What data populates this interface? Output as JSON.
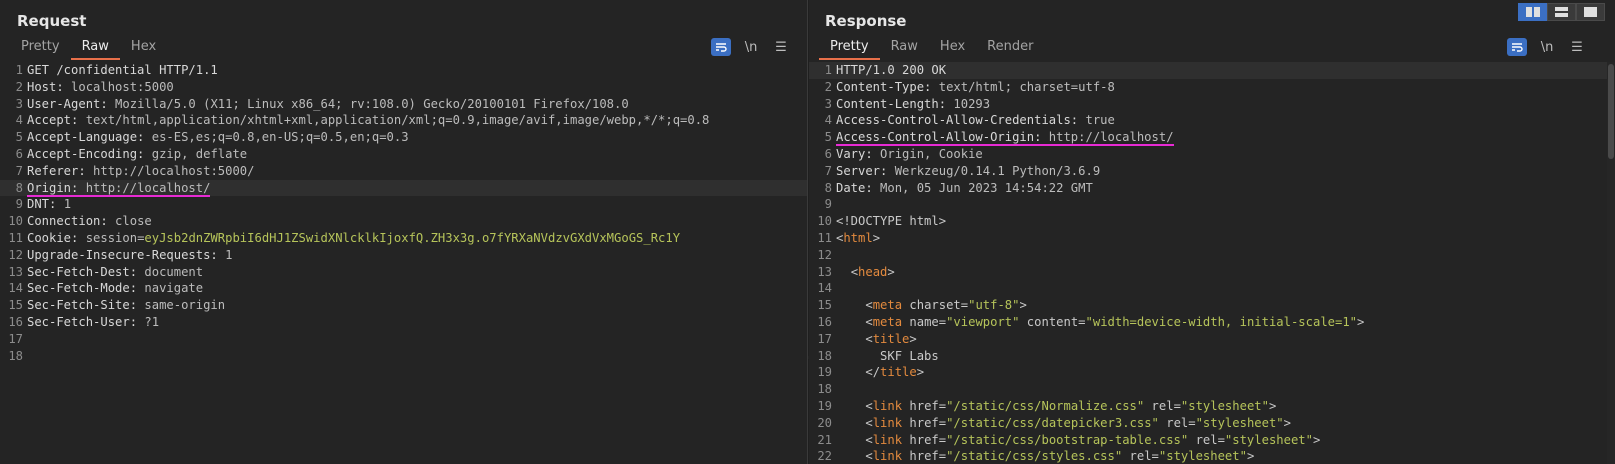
{
  "request": {
    "title": "Request",
    "tabs": [
      {
        "label": "Pretty",
        "active": false
      },
      {
        "label": "Raw",
        "active": true
      },
      {
        "label": "Hex",
        "active": false
      }
    ],
    "tools": {
      "wrap_icon": "wrap-icon",
      "newline_label": "\\n",
      "menu_icon": "menu-icon"
    },
    "lines": [
      {
        "n": "1",
        "k": "GET /confidential HTTP/1.1",
        "v": ""
      },
      {
        "n": "2",
        "k": "Host:",
        "v": " localhost:5000"
      },
      {
        "n": "3",
        "k": "User-Agent:",
        "v": " Mozilla/5.0 (X11; Linux x86_64; rv:108.0) Gecko/20100101 Firefox/108.0"
      },
      {
        "n": "4",
        "k": "Accept:",
        "v": " text/html,application/xhtml+xml,application/xml;q=0.9,image/avif,image/webp,*/*;q=0.8"
      },
      {
        "n": "5",
        "k": "Accept-Language:",
        "v": " es-ES,es;q=0.8,en-US;q=0.5,en;q=0.3"
      },
      {
        "n": "6",
        "k": "Accept-Encoding:",
        "v": " gzip, deflate"
      },
      {
        "n": "7",
        "k": "Referer:",
        "v": " http://localhost:5000/"
      },
      {
        "n": "8",
        "k": "Origin:",
        "v": " http://localhost/"
      },
      {
        "n": "9",
        "k": "DNT:",
        "v": " 1"
      },
      {
        "n": "10",
        "k": "Connection:",
        "v": " close"
      },
      {
        "n": "11",
        "k": "Cookie:",
        "v": " session=",
        "cookie": "eyJsb2dnZWRpbiI6dHJ1ZSwidXNlcklkIjoxfQ.ZH3x3g.o7fYRXaNVdzvGXdVxMGoGS_Rc1Y"
      },
      {
        "n": "12",
        "k": "Upgrade-Insecure-Requests:",
        "v": " 1"
      },
      {
        "n": "13",
        "k": "Sec-Fetch-Dest:",
        "v": " document"
      },
      {
        "n": "14",
        "k": "Sec-Fetch-Mode:",
        "v": " navigate"
      },
      {
        "n": "15",
        "k": "Sec-Fetch-Site:",
        "v": " same-origin"
      },
      {
        "n": "16",
        "k": "Sec-Fetch-User:",
        "v": " ?1"
      },
      {
        "n": "17",
        "k": "",
        "v": ""
      },
      {
        "n": "18",
        "k": "",
        "v": ""
      }
    ]
  },
  "response": {
    "title": "Response",
    "tabs": [
      {
        "label": "Pretty",
        "active": true
      },
      {
        "label": "Raw",
        "active": false
      },
      {
        "label": "Hex",
        "active": false
      },
      {
        "label": "Render",
        "active": false
      }
    ],
    "tools": {
      "wrap_icon": "wrap-icon",
      "newline_label": "\\n",
      "menu_icon": "menu-icon"
    },
    "headers": [
      {
        "n": "1",
        "k": "HTTP/1.0 200 OK",
        "v": ""
      },
      {
        "n": "2",
        "k": "Content-Type:",
        "v": " text/html; charset=utf-8"
      },
      {
        "n": "3",
        "k": "Content-Length:",
        "v": " 10293"
      },
      {
        "n": "4",
        "k": "Access-Control-Allow-Credentials:",
        "v": " true"
      },
      {
        "n": "5",
        "k": "Access-Control-Allow-Origin:",
        "v": " http://localhost/"
      },
      {
        "n": "6",
        "k": "Vary:",
        "v": " Origin, Cookie"
      },
      {
        "n": "7",
        "k": "Server:",
        "v": " Werkzeug/0.14.1 Python/3.6.9"
      },
      {
        "n": "8",
        "k": "Date:",
        "v": " Mon, 05 Jun 2023 14:54:22 GMT"
      },
      {
        "n": "9",
        "k": "",
        "v": ""
      }
    ],
    "html_lines": [
      {
        "n": "10",
        "indent": "",
        "parts": [
          {
            "t": "<!DOCTYPE html>",
            "c": "attr"
          }
        ]
      },
      {
        "n": "11",
        "indent": "",
        "parts": [
          {
            "t": "<",
            "c": "attr"
          },
          {
            "t": "html",
            "c": "tag"
          },
          {
            "t": ">",
            "c": "attr"
          }
        ]
      },
      {
        "n": "12",
        "indent": "",
        "parts": []
      },
      {
        "n": "13",
        "indent": "  ",
        "parts": [
          {
            "t": "<",
            "c": "attr"
          },
          {
            "t": "head",
            "c": "tag"
          },
          {
            "t": ">",
            "c": "attr"
          }
        ]
      },
      {
        "n": "14",
        "indent": "",
        "parts": []
      },
      {
        "n": "15",
        "indent": "    ",
        "parts": [
          {
            "t": "<",
            "c": "attr"
          },
          {
            "t": "meta",
            "c": "tag"
          },
          {
            "t": " charset=",
            "c": "attr"
          },
          {
            "t": "\"utf-8\"",
            "c": "str"
          },
          {
            "t": ">",
            "c": "attr"
          }
        ]
      },
      {
        "n": "16",
        "indent": "    ",
        "parts": [
          {
            "t": "<",
            "c": "attr"
          },
          {
            "t": "meta",
            "c": "tag"
          },
          {
            "t": " name=",
            "c": "attr"
          },
          {
            "t": "\"viewport\"",
            "c": "str"
          },
          {
            "t": " content=",
            "c": "attr"
          },
          {
            "t": "\"width=device-width, initial-scale=1\"",
            "c": "str"
          },
          {
            "t": ">",
            "c": "attr"
          }
        ]
      },
      {
        "n": "17",
        "indent": "    ",
        "parts": [
          {
            "t": "<",
            "c": "attr"
          },
          {
            "t": "title",
            "c": "tag"
          },
          {
            "t": ">",
            "c": "attr"
          }
        ]
      },
      {
        "n": "18",
        "indent": "      ",
        "parts": [
          {
            "t": "SKF Labs",
            "c": "attr"
          }
        ]
      },
      {
        "n": "19",
        "indent": "    ",
        "parts": [
          {
            "t": "</",
            "c": "attr"
          },
          {
            "t": "title",
            "c": "tag"
          },
          {
            "t": ">",
            "c": "attr"
          }
        ]
      },
      {
        "n": "18",
        "indent": "",
        "parts": []
      },
      {
        "n": "19",
        "indent": "    ",
        "parts": [
          {
            "t": "<",
            "c": "attr"
          },
          {
            "t": "link",
            "c": "tag"
          },
          {
            "t": " href=",
            "c": "attr"
          },
          {
            "t": "\"/static/css/Normalize.css\"",
            "c": "str"
          },
          {
            "t": " rel=",
            "c": "attr"
          },
          {
            "t": "\"stylesheet\"",
            "c": "str"
          },
          {
            "t": ">",
            "c": "attr"
          }
        ]
      },
      {
        "n": "20",
        "indent": "    ",
        "parts": [
          {
            "t": "<",
            "c": "attr"
          },
          {
            "t": "link",
            "c": "tag"
          },
          {
            "t": " href=",
            "c": "attr"
          },
          {
            "t": "\"/static/css/datepicker3.css\"",
            "c": "str"
          },
          {
            "t": " rel=",
            "c": "attr"
          },
          {
            "t": "\"stylesheet\"",
            "c": "str"
          },
          {
            "t": ">",
            "c": "attr"
          }
        ]
      },
      {
        "n": "21",
        "indent": "    ",
        "parts": [
          {
            "t": "<",
            "c": "attr"
          },
          {
            "t": "link",
            "c": "tag"
          },
          {
            "t": " href=",
            "c": "attr"
          },
          {
            "t": "\"/static/css/bootstrap-table.css\"",
            "c": "str"
          },
          {
            "t": " rel=",
            "c": "attr"
          },
          {
            "t": "\"stylesheet\"",
            "c": "str"
          },
          {
            "t": ">",
            "c": "attr"
          }
        ]
      },
      {
        "n": "22",
        "indent": "    ",
        "parts": [
          {
            "t": "<",
            "c": "attr"
          },
          {
            "t": "link",
            "c": "tag"
          },
          {
            "t": " href=",
            "c": "attr"
          },
          {
            "t": "\"/static/css/styles.css\"",
            "c": "str"
          },
          {
            "t": " rel=",
            "c": "attr"
          },
          {
            "t": "\"stylesheet\"",
            "c": "str"
          },
          {
            "t": ">",
            "c": "attr"
          }
        ]
      }
    ]
  },
  "layout_buttons": [
    {
      "name": "side-by-side-layout-icon",
      "active": true
    },
    {
      "name": "stacked-layout-icon",
      "active": false
    },
    {
      "name": "single-pane-layout-icon",
      "active": false
    }
  ],
  "highlight_color": "#e82ad4"
}
